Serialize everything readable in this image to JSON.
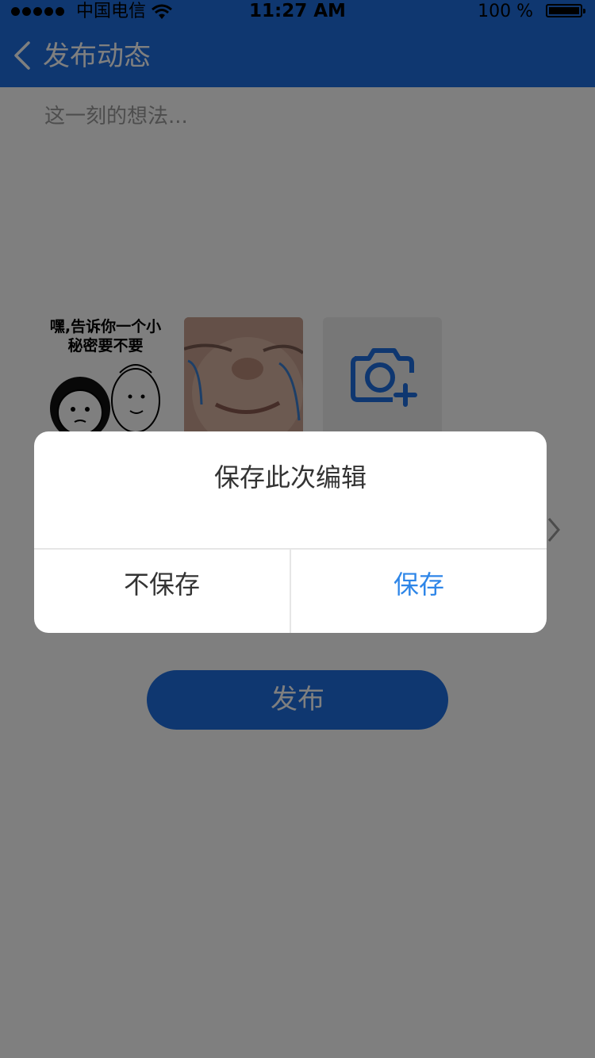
{
  "status_bar": {
    "carrier": "中国电信",
    "time": "11:27 AM",
    "battery": "100 %"
  },
  "nav": {
    "title": "发布动态",
    "back_icon": "chevron-left-icon"
  },
  "post": {
    "placeholder": "这一刻的想法..."
  },
  "images": [
    {
      "type": "meme",
      "caption": "嘿,告诉你一个小秘密要不要"
    },
    {
      "type": "photo"
    },
    {
      "type": "add-photo",
      "icon": "camera-plus-icon"
    }
  ],
  "publish_label": "发布",
  "dialog": {
    "title": "保存此次编辑",
    "cancel_label": "不保存",
    "save_label": "保存"
  },
  "colors": {
    "primary": "#1f6fe0",
    "dialog_accent": "#2e86e8",
    "overlay": "rgba(0,0,0,0.5)"
  }
}
